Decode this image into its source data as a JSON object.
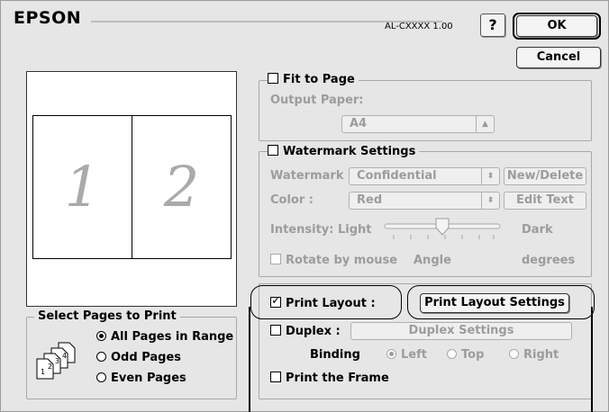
{
  "header": {
    "brand": "EPSON",
    "model": "AL-CXXXX 1.00",
    "help_label": "?",
    "ok_label": "OK",
    "cancel_label": "Cancel"
  },
  "preview": {
    "page_left": "1",
    "page_right": "2"
  },
  "select_pages": {
    "title": "Select Pages to Print",
    "options": [
      "All Pages in Range",
      "Odd Pages",
      "Even Pages"
    ],
    "selected": "All Pages in Range"
  },
  "fit_to_page": {
    "label": "Fit to Page",
    "checked": false,
    "output_paper_label": "Output Paper:",
    "output_paper_value": "A4"
  },
  "watermark": {
    "label": "Watermark Settings",
    "checked": false,
    "watermark_label": "Watermark :",
    "watermark_value": "Confidential",
    "new_delete_label": "New/Delete",
    "color_label": "Color :",
    "color_value": "Red",
    "edit_text_label": "Edit Text",
    "intensity_label": "Intensity: Light",
    "intensity_dark": "Dark",
    "intensity_level": 0.5,
    "rotate_label": "Rotate by mouse",
    "angle_label": "Angle",
    "degrees_label": "degrees"
  },
  "print_layout": {
    "label": "Print Layout :",
    "checked": true,
    "settings_button": "Print Layout Settings"
  },
  "duplex": {
    "label": "Duplex :",
    "checked": false,
    "settings_button": "Duplex Settings",
    "binding_label": "Binding",
    "binding_options": [
      "Left",
      "Top",
      "Right"
    ],
    "binding_selected": "Left"
  },
  "print_frame": {
    "label": "Print the Frame",
    "checked": false
  }
}
